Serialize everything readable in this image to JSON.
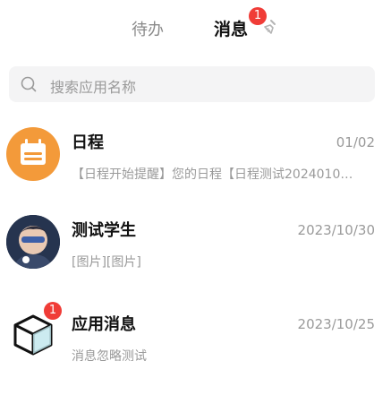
{
  "tabs": {
    "todo_label": "待办",
    "messages_label": "消息",
    "messages_badge": "1"
  },
  "search": {
    "placeholder": "搜索应用名称"
  },
  "conversations": [
    {
      "title": "日程",
      "time": "01/02",
      "preview": "【日程开始提醒】您的日程【日程测试2024010…",
      "icon": "calendar-icon",
      "icon_bg": "#f39a3a"
    },
    {
      "title": "测试学生",
      "time": "2023/10/30",
      "preview": "[图片][图片]",
      "icon": "user-avatar"
    },
    {
      "title": "应用消息",
      "time": "2023/10/25",
      "preview": "消息忽略测试",
      "icon": "package-box-icon",
      "badge": "1"
    }
  ],
  "colors": {
    "badge": "#f03c37",
    "accent_orange": "#f39a3a",
    "muted_text": "#9a9a9a"
  }
}
